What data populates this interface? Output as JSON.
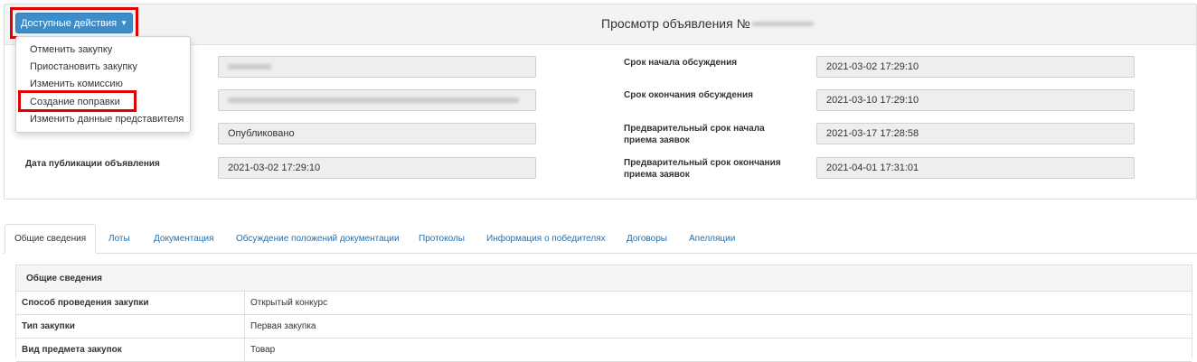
{
  "header": {
    "title_prefix": "Просмотр объявления №",
    "actions_button_label": "Доступные действия",
    "actions_menu": [
      "Отменить закупку",
      "Приостановить закупку",
      "Изменить комиссию",
      "Создание поправки",
      "Изменить данные представителя"
    ]
  },
  "left_fields": {
    "status_value": "Опубликовано",
    "publication_date_label": "Дата публикации объявления",
    "publication_date_value": "2021-03-02 17:29:10"
  },
  "right_fields": [
    {
      "label": "Срок начала обсуждения",
      "value": "2021-03-02 17:29:10"
    },
    {
      "label": "Срок окончания обсуждения",
      "value": "2021-03-10 17:29:10"
    },
    {
      "label": "Предварительный срок начала приема заявок",
      "value": "2021-03-17 17:28:58"
    },
    {
      "label": "Предварительный срок окончания приема заявок",
      "value": "2021-04-01 17:31:01"
    }
  ],
  "tabs": [
    "Общие сведения",
    "Лоты",
    "Документация",
    "Обсуждение положений документации",
    "Протоколы",
    "Информация о победителях",
    "Договоры",
    "Апелляции"
  ],
  "general_info": {
    "title": "Общие сведения",
    "rows": [
      {
        "key": "Способ проведения закупки",
        "value": "Открытый конкурс"
      },
      {
        "key": "Тип закупки",
        "value": "Первая закупка"
      },
      {
        "key": "Вид предмета закупок",
        "value": "Товар"
      }
    ]
  },
  "highlight_color": "#e00000",
  "accent_color": "#3d8ec8"
}
